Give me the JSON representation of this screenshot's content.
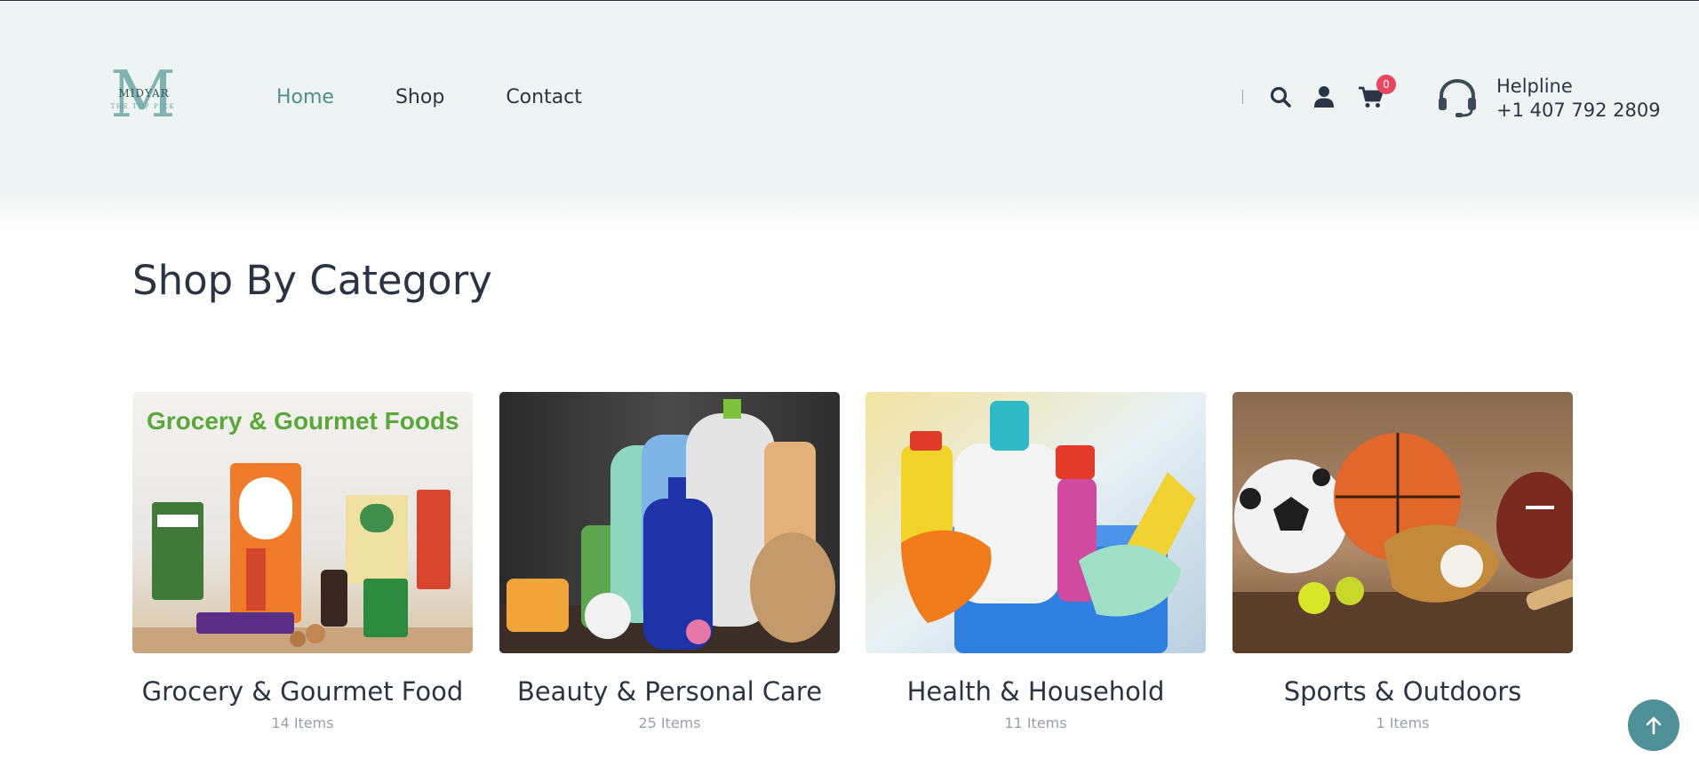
{
  "header": {
    "logo": {
      "letter": "M",
      "wordmark": "MIDYAR",
      "tagline": "THE TOP PICK"
    },
    "nav": [
      {
        "label": "Home",
        "active": true
      },
      {
        "label": "Shop",
        "active": false
      },
      {
        "label": "Contact",
        "active": false
      }
    ],
    "cart_count": "0",
    "helpline": {
      "label": "Helpline",
      "phone": "+1 407 792 2809"
    }
  },
  "section": {
    "title": "Shop By Category",
    "categories": [
      {
        "name": "Grocery & Gourmet Food",
        "count": "14 Items",
        "image_text": "Grocery & Gourmet Foods"
      },
      {
        "name": "Beauty & Personal Care",
        "count": "25 Items"
      },
      {
        "name": "Health & Household",
        "count": "11 Items"
      },
      {
        "name": "Sports & Outdoors",
        "count": "1 Items"
      }
    ]
  },
  "icons": {
    "search": "search-icon",
    "user": "user-icon",
    "cart": "cart-icon",
    "headset": "headset-icon",
    "scroll_top": "arrow-up-icon"
  },
  "colors": {
    "header_bg": "#edf4f3",
    "accent": "#4f8f8c",
    "badge": "#e94560",
    "text": "#2b3445",
    "scroll_button": "#4f9197"
  }
}
